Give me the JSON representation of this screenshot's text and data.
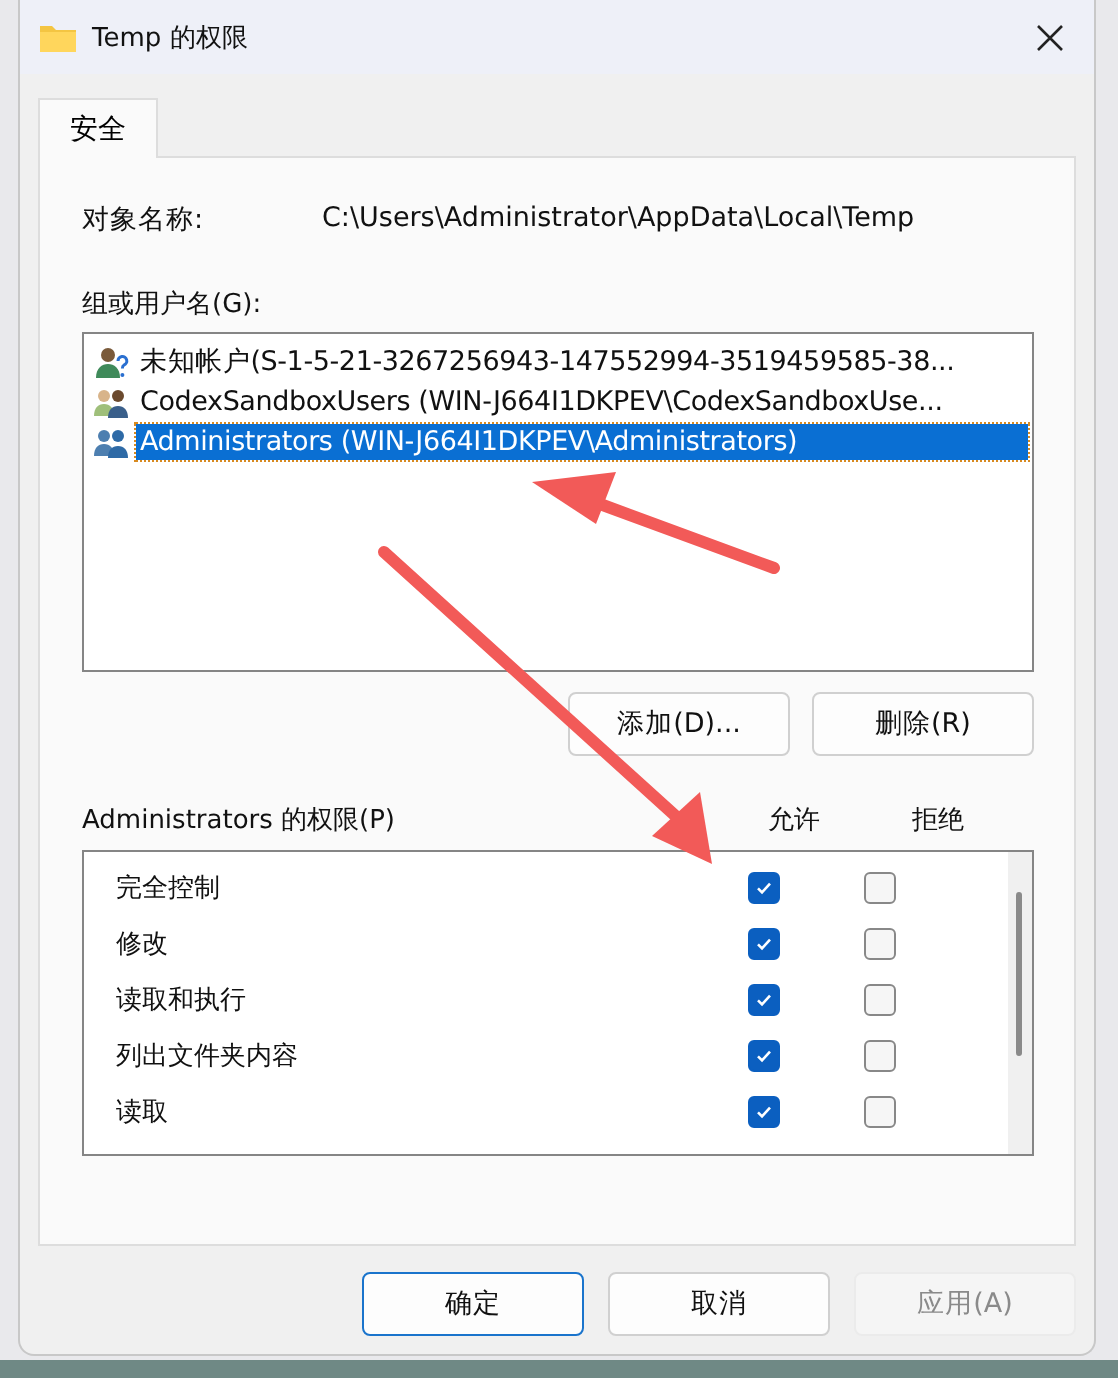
{
  "window": {
    "title": "Temp 的权限"
  },
  "tabs": [
    {
      "label": "安全",
      "selected": true
    }
  ],
  "object_name": {
    "label": "对象名称:",
    "value": "C:\\Users\\Administrator\\AppData\\Local\\Temp"
  },
  "groups": {
    "label": "组或用户名(G):",
    "items": [
      {
        "name": "未知帐户(S-1-5-21-3267256943-147552994-3519459585-38...",
        "kind": "unknown",
        "selected": false
      },
      {
        "name": "CodexSandboxUsers (WIN-J664I1DKPEV\\CodexSandboxUse...",
        "kind": "group",
        "selected": false
      },
      {
        "name": "Administrators (WIN-J664I1DKPEV\\Administrators)",
        "kind": "admin",
        "selected": true
      }
    ]
  },
  "group_buttons": [
    "添加(D)...",
    "删除(R)"
  ],
  "permissions": {
    "label": "Administrators 的权限(P)",
    "columns": [
      "允许",
      "拒绝"
    ],
    "rows": [
      {
        "name": "完全控制",
        "allow": true,
        "deny": false
      },
      {
        "name": "修改",
        "allow": true,
        "deny": false
      },
      {
        "name": "读取和执行",
        "allow": true,
        "deny": false
      },
      {
        "name": "列出文件夹内容",
        "allow": true,
        "deny": false
      },
      {
        "name": "读取",
        "allow": true,
        "deny": false
      }
    ]
  },
  "footer_buttons": [
    {
      "label": "确定",
      "default": true,
      "disabled": false
    },
    {
      "label": "取消",
      "default": false,
      "disabled": false
    },
    {
      "label": "应用(A)",
      "default": false,
      "disabled": true
    }
  ]
}
